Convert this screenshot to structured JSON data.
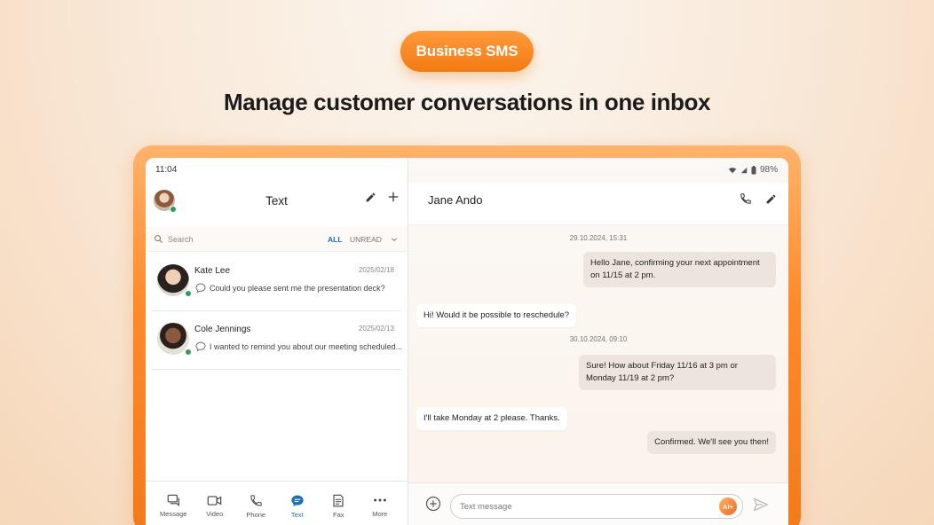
{
  "hero": {
    "badge": "Business SMS",
    "headline": "Manage customer conversations in one inbox"
  },
  "status_bar": {
    "time": "11:04",
    "battery": "98%"
  },
  "left_pane": {
    "title": "Text",
    "search_placeholder": "Search",
    "filters": {
      "all": "ALL",
      "unread": "UNREAD"
    },
    "conversations": [
      {
        "name": "Kate Lee",
        "date": "2025/02/18",
        "preview": "Could you please sent me the presentation deck?"
      },
      {
        "name": "Cole Jennings",
        "date": "2025/02/13",
        "preview": "I wanted to remind you about our meeting scheduled..."
      }
    ],
    "nav": [
      {
        "label": "Message",
        "icon": "message-icon",
        "active": false
      },
      {
        "label": "Video",
        "icon": "video-icon",
        "active": false
      },
      {
        "label": "Phone",
        "icon": "phone-icon",
        "active": false
      },
      {
        "label": "Text",
        "icon": "text-bubble-icon",
        "active": true
      },
      {
        "label": "Fax",
        "icon": "fax-icon",
        "active": false
      },
      {
        "label": "More",
        "icon": "more-icon",
        "active": false
      }
    ]
  },
  "chat": {
    "contact_name": "Jane Ando",
    "stamps": [
      "29.10.2024, 15:31",
      "30.10.2024, 09:10"
    ],
    "messages": [
      {
        "direction": "out",
        "text": "Hello Jane, confirming your next appointment on 11/15 at 2 pm."
      },
      {
        "direction": "in",
        "text": "Hi! Would it be possible to reschedule?"
      },
      {
        "direction": "out",
        "text": "Sure! How about Friday 11/16 at 3 pm or Monday 11/19 at 2 pm?"
      },
      {
        "direction": "in",
        "text": "I'll take Monday at 2 please. Thanks."
      },
      {
        "direction": "out",
        "text": "Confirmed. We'll see you then!"
      }
    ],
    "composer_placeholder": "Text message",
    "ai_label": "AI+"
  },
  "colors": {
    "accent_orange": "#f37a12",
    "link_blue": "#1b6fb8",
    "online_green": "#2e9e4c"
  }
}
